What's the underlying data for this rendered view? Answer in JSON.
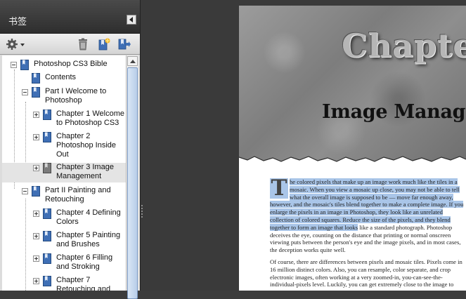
{
  "panel": {
    "title": "书签",
    "toolbar": {
      "options_icon": "gear-icon",
      "delete_icon": "trash-icon",
      "new_icon": "new-bookmark-icon",
      "expand_icon": "expand-bookmark-icon"
    }
  },
  "tree": [
    {
      "label": "Photoshop CS3 Bible",
      "level": 0,
      "toggle": "minus",
      "selected": false
    },
    {
      "label": "Contents",
      "level": 1,
      "toggle": "none",
      "selected": false
    },
    {
      "label": "Part I Welcome to Photoshop",
      "level": 1,
      "toggle": "minus",
      "selected": false
    },
    {
      "label": "Chapter 1 Welcome to Photoshop CS3",
      "level": 2,
      "toggle": "plus",
      "selected": false
    },
    {
      "label": "Chapter 2 Photoshop Inside Out",
      "level": 2,
      "toggle": "plus",
      "selected": false
    },
    {
      "label": "Chapter 3 Image Management",
      "level": 2,
      "toggle": "plus",
      "selected": true
    },
    {
      "label": "Part II Painting and Retouching",
      "level": 1,
      "toggle": "minus",
      "selected": false
    },
    {
      "label": "Chapter 4 Defining Colors",
      "level": 2,
      "toggle": "plus",
      "selected": false
    },
    {
      "label": "Chapter 5 Painting and Brushes",
      "level": 2,
      "toggle": "plus",
      "selected": false
    },
    {
      "label": "Chapter 6 Filling and Stroking",
      "level": 2,
      "toggle": "plus",
      "selected": false
    },
    {
      "label": "Chapter 7 Retouching and",
      "level": 2,
      "toggle": "plus",
      "selected": false
    }
  ],
  "document": {
    "chapter_word": "Chapter",
    "chapter_title": "Image Management",
    "dropcap": "T",
    "p1_highlighted": "he colored pixels that make up an image work much like the tiles in a mosaic. When you view a mosaic up close, you may not be able to tell what the overall image is supposed to be — move far enough away, however, and the mosaic's tiles blend together to make a complete image. If you enlarge the pixels in an image in Photoshop, they look like an unrelated collection of colored squares. Reduce the size of the pixels, and they blend together to form an image that looks",
    "p1_rest": " like a standard photograph. Photoshop deceives the eye, counting on the distance that printing or normal onscreen viewing puts between the person's eye and the image pixels, and in most cases, the deception works quite well.",
    "p2": "Of course, there are differences between pixels and mosaic tiles. Pixels come in 16 million distinct colors. Also, you can resample, color separate, and crop electronic images, often working at a very zoomed-in, you-can-see-the-individual-pixels level. Luckily, you can get extremely close to the image to"
  }
}
